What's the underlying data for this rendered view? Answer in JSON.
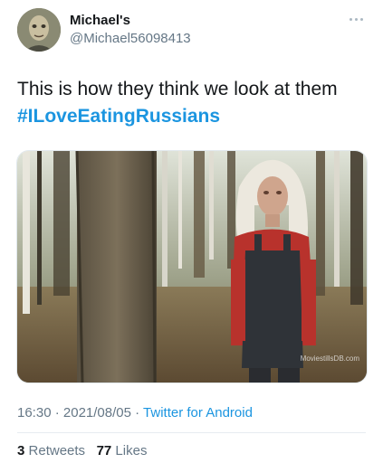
{
  "user": {
    "display_name": "Michael's",
    "handle": "@Michael56098413"
  },
  "tweet": {
    "text": "This is how they think we look at them",
    "hashtag": "#ILoveEatingRussians",
    "media_watermark": "MoviestillsDB.com"
  },
  "meta": {
    "time": "16:30",
    "separator1": " · ",
    "date": "2021/08/05",
    "separator2": " · ",
    "source": "Twitter for Android"
  },
  "stats": {
    "retweets_count": "3",
    "retweets_label": "Retweets",
    "likes_count": "77",
    "likes_label": "Likes"
  },
  "colors": {
    "link": "#1b95e0",
    "secondary_text": "#657786",
    "primary_text": "#14171a"
  },
  "icons": {
    "more": "more-horizontal-icon"
  }
}
